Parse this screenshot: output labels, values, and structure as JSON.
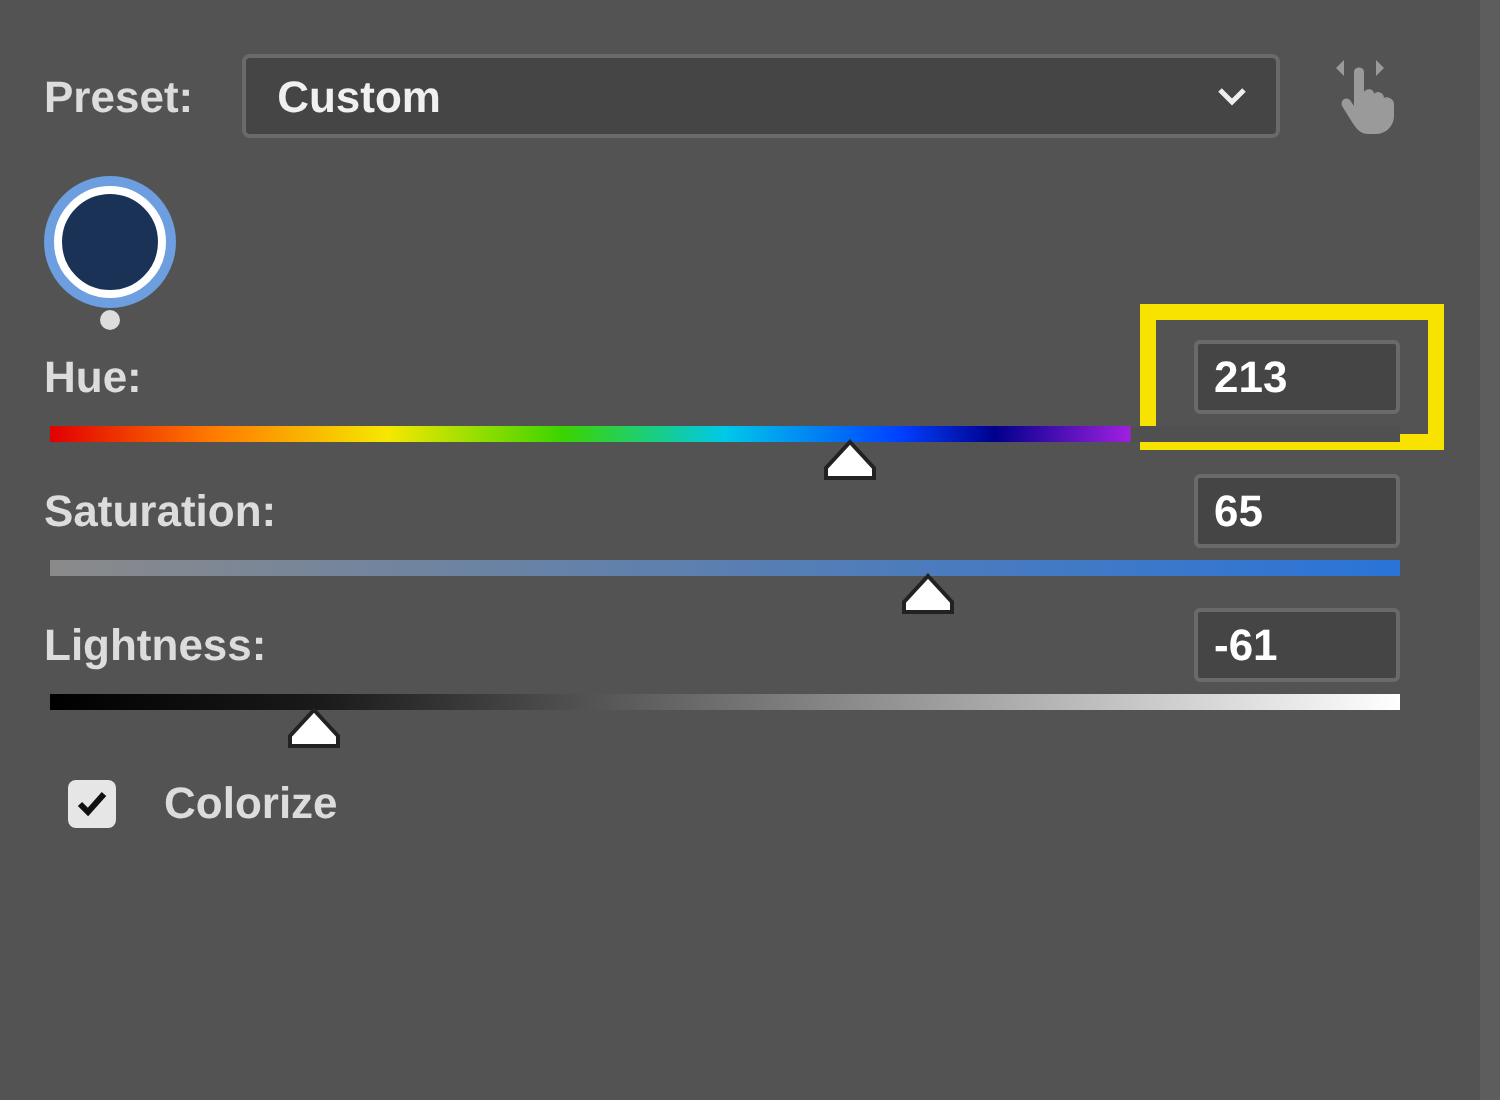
{
  "preset": {
    "label": "Preset:",
    "value": "Custom"
  },
  "sliders": [
    {
      "kind": "hue",
      "label": "Hue:",
      "value": "213",
      "level": 0.593,
      "highlighted": true
    },
    {
      "kind": "saturation",
      "label": "Saturation:",
      "value": "65",
      "level": 0.65,
      "highlighted": false
    },
    {
      "kind": "lightness",
      "label": "Lightness:",
      "value": "-61",
      "level": 0.195,
      "highlighted": false
    }
  ],
  "colorize": {
    "label": "Colorize",
    "checked": true
  }
}
